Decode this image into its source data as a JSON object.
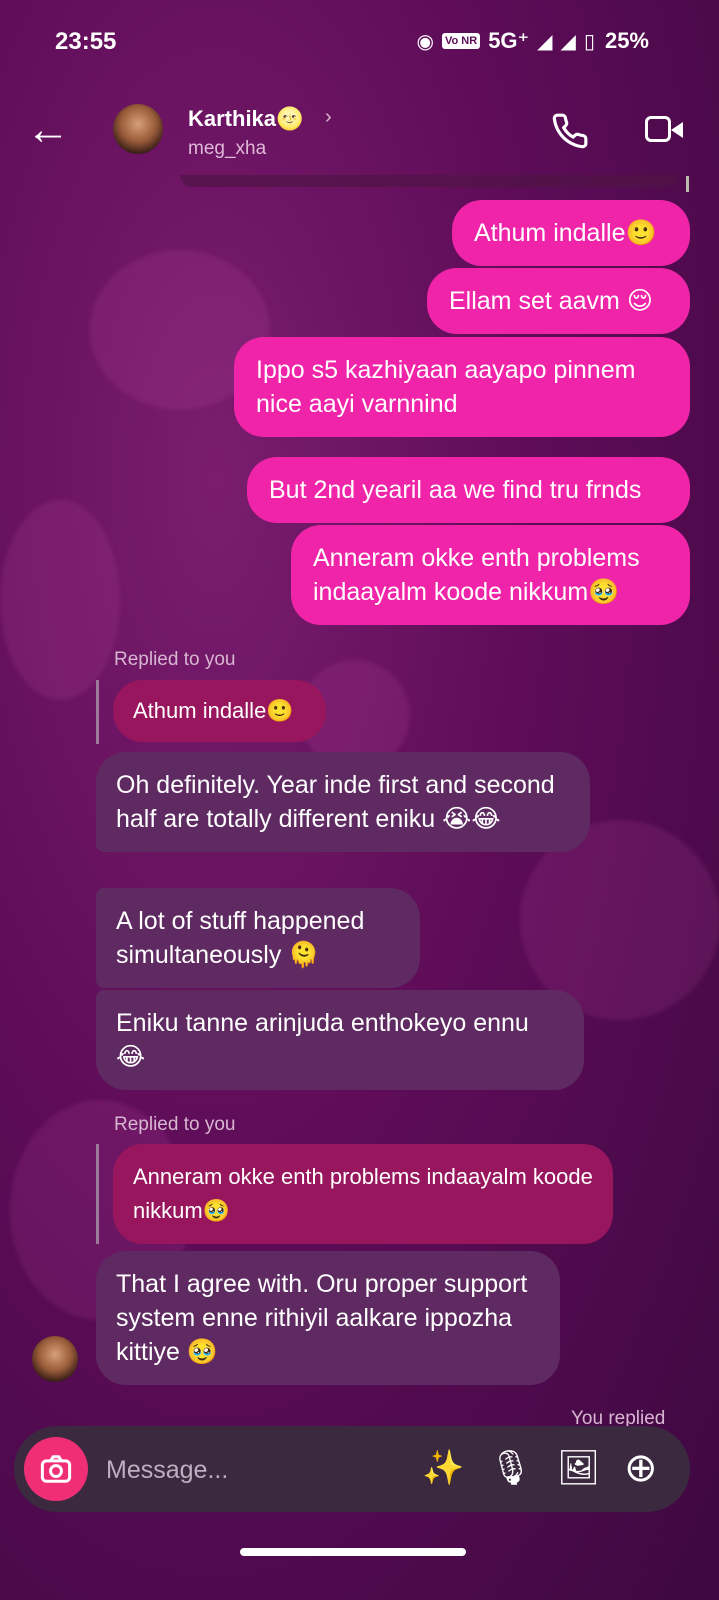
{
  "status": {
    "time": "23:55",
    "network": "5G⁺",
    "battery": "25%",
    "volte": "Vo NR"
  },
  "header": {
    "name": "Karthika🌝",
    "username": "meg_xha"
  },
  "messages": {
    "m1": "Athum indalle🙂",
    "m2": "Ellam set aavm 😌",
    "m3": "Ippo s5 kazhiyaan aayapo pinnem nice aayi varnnind",
    "m4": "But 2nd yearil aa we find tru frnds",
    "m5": "Anneram okke enth problems indaayalm koode nikkum🥹",
    "replied_label_1": "Replied to you",
    "quote1": "Athum indalle🙂",
    "t1": "Oh definitely. Year inde first and second half are totally different eniku 😭😂",
    "t2": "A lot of stuff happened simultaneously 🫠",
    "t3": "Eniku tanne arinjuda enthokeyo ennu 😂",
    "replied_label_2": "Replied to you",
    "quote2": "Anneram okke enth problems indaayalm koode nikkum🥹",
    "t4": "That I agree with. Oru proper support system enne rithiyil aalkare ippozha kittiye 🥹",
    "you_replied": "You replied"
  },
  "composer": {
    "placeholder": "Message..."
  },
  "icons": {
    "back": "←",
    "call": "📞",
    "camera": "📷",
    "sticker": "✨",
    "mic": "🎙",
    "gallery": "🖼",
    "plus": "⊕",
    "chevron": "›"
  }
}
